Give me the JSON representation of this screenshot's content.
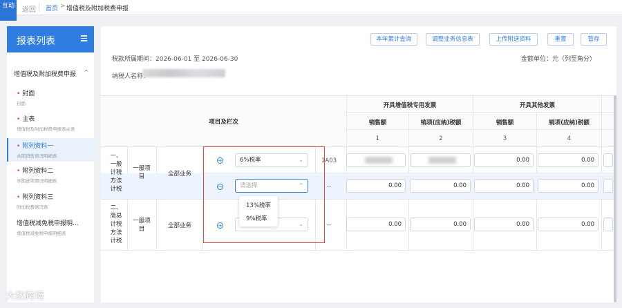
{
  "topbar": {
    "badge": "互动",
    "back": "返回",
    "home": "首页",
    "arrow": ">",
    "current": "增值税及附加税费申报"
  },
  "sidebar": {
    "title": "报表列表",
    "group": "增值税及附加税费申报",
    "group_caret": "^",
    "items": [
      {
        "label": "封面",
        "sub": "封面",
        "required": true
      },
      {
        "label": "主表",
        "sub": "增值税及附加税费申报表主表",
        "required": true
      },
      {
        "label": "附列资料一",
        "sub": "本期销售情况明细表",
        "required": true,
        "active": true
      },
      {
        "label": "附列资料二",
        "sub": "本期进项情况明细表",
        "required": true
      },
      {
        "label": "附列资料三",
        "sub": "附加税费情况表",
        "required": true
      },
      {
        "label": "增值税减免税申报明...",
        "sub": "增值税减免税申报明细表",
        "required": false
      }
    ]
  },
  "toolbar": {
    "btn1": "本年累计查询",
    "btn2": "调整业务信息表",
    "btn3": "上传附送资料",
    "btn4": "重置",
    "btn5": "暂存"
  },
  "info": {
    "period": "税款所属期间：2026-06-01 至 2026-06-30",
    "unit": "金额单位：元（列至角分）",
    "taxpayer": "纳税人名称："
  },
  "table": {
    "header_item": "项目及栏次",
    "group1": "开具增值税专用发票",
    "group2": "开具其他发票",
    "col_sales": "销售额",
    "col_tax": "销项(应纳)税额",
    "nums": [
      "1",
      "2",
      "3",
      "4"
    ],
    "row1_label": "一、一般计税方法计税",
    "row2_label": "二、简易计税方法计税",
    "general_item": "一般项目",
    "all_business": "全部业务",
    "code": "1A03",
    "dash": "--",
    "sel1_value": "6%税率",
    "sel2_placeholder": "请选择",
    "sel3_placeholder": "请选择",
    "zero": "0.00",
    "plus": "+",
    "minus": "−"
  },
  "dropdown": {
    "opt1": "13%税率",
    "opt2": "9%税率"
  },
  "watermark": "大数跨境"
}
